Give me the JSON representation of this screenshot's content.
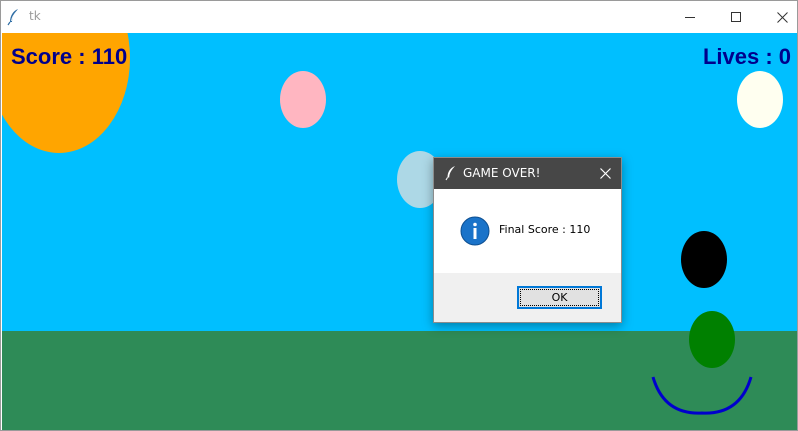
{
  "window": {
    "title": "tk",
    "icon": "feather-icon",
    "controls": [
      "minimize-icon",
      "maximize-icon",
      "close-icon"
    ]
  },
  "game": {
    "score_text": "Score : 110",
    "lives_text": "Lives : 0",
    "score": 110,
    "lives": 0,
    "colors": {
      "sky": "#00bfff",
      "ground": "#2e8b57",
      "sun": "#ffa500",
      "hud_text": "#00008b",
      "smile": "#0000cd"
    },
    "balloons": [
      {
        "color": "#ffb6c1"
      },
      {
        "color": "#fffff0"
      },
      {
        "color": "#add8e6"
      },
      {
        "color": "#000000"
      },
      {
        "color": "#008000"
      }
    ]
  },
  "dialog": {
    "title": "GAME OVER!",
    "icon": "info-icon",
    "message": "Final Score : 110",
    "ok_label": "OK"
  }
}
